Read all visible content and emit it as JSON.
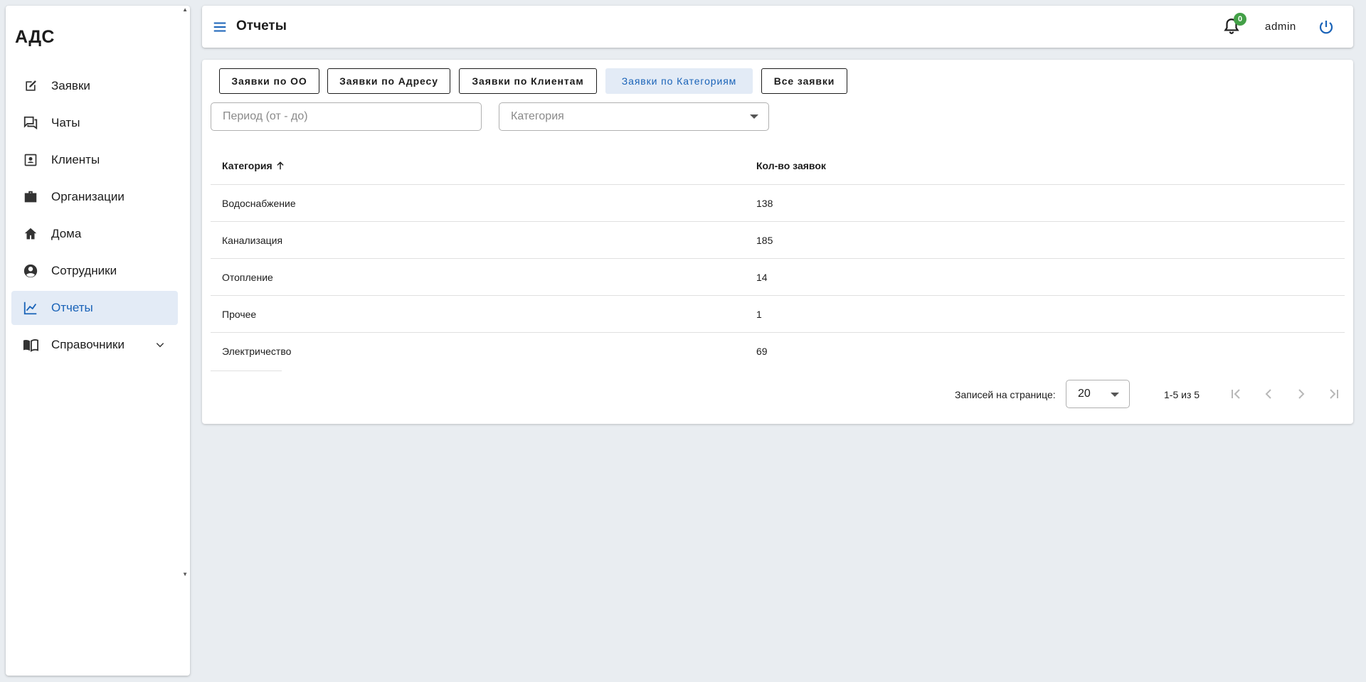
{
  "app": {
    "logo": "АДС"
  },
  "sidebar": {
    "items": [
      {
        "label": "Заявки",
        "icon": "edit-note-icon"
      },
      {
        "label": "Чаты",
        "icon": "forum-icon"
      },
      {
        "label": "Клиенты",
        "icon": "contact-card-icon"
      },
      {
        "label": "Организации",
        "icon": "briefcase-icon"
      },
      {
        "label": "Дома",
        "icon": "home-icon"
      },
      {
        "label": "Сотрудники",
        "icon": "account-circle-icon"
      },
      {
        "label": "Отчеты",
        "icon": "chart-line-icon",
        "active": true
      },
      {
        "label": "Справочники",
        "icon": "book-icon",
        "expandable": true
      }
    ]
  },
  "header": {
    "title": "Отчеты",
    "notifications_count": "0",
    "username": "admin"
  },
  "report": {
    "tabs": [
      {
        "label": "Заявки по ОО"
      },
      {
        "label": "Заявки по Адресу"
      },
      {
        "label": "Заявки по Клиентам"
      },
      {
        "label": "Заявки по Категориям",
        "active": true
      },
      {
        "label": "Все заявки"
      }
    ],
    "filters": {
      "period_placeholder": "Период (от - до)",
      "category_placeholder": "Категория"
    },
    "table": {
      "columns": [
        "Категория",
        "Кол-во заявок"
      ],
      "sorted_column": "Категория",
      "sort_direction": "asc",
      "rows": [
        {
          "category": "Водоснабжение",
          "count": "138"
        },
        {
          "category": "Канализация",
          "count": "185"
        },
        {
          "category": "Отопление",
          "count": "14"
        },
        {
          "category": "Прочее",
          "count": "1"
        },
        {
          "category": "Электричество",
          "count": "69"
        }
      ]
    },
    "pagination": {
      "rows_per_page_label": "Записей на странице:",
      "rows_per_page": "20",
      "range": "1-5 из 5"
    }
  },
  "colors": {
    "accent": "#1a63b8",
    "active_bg": "#e3ebf6",
    "badge": "#43a047",
    "background": "#e9edf1"
  }
}
